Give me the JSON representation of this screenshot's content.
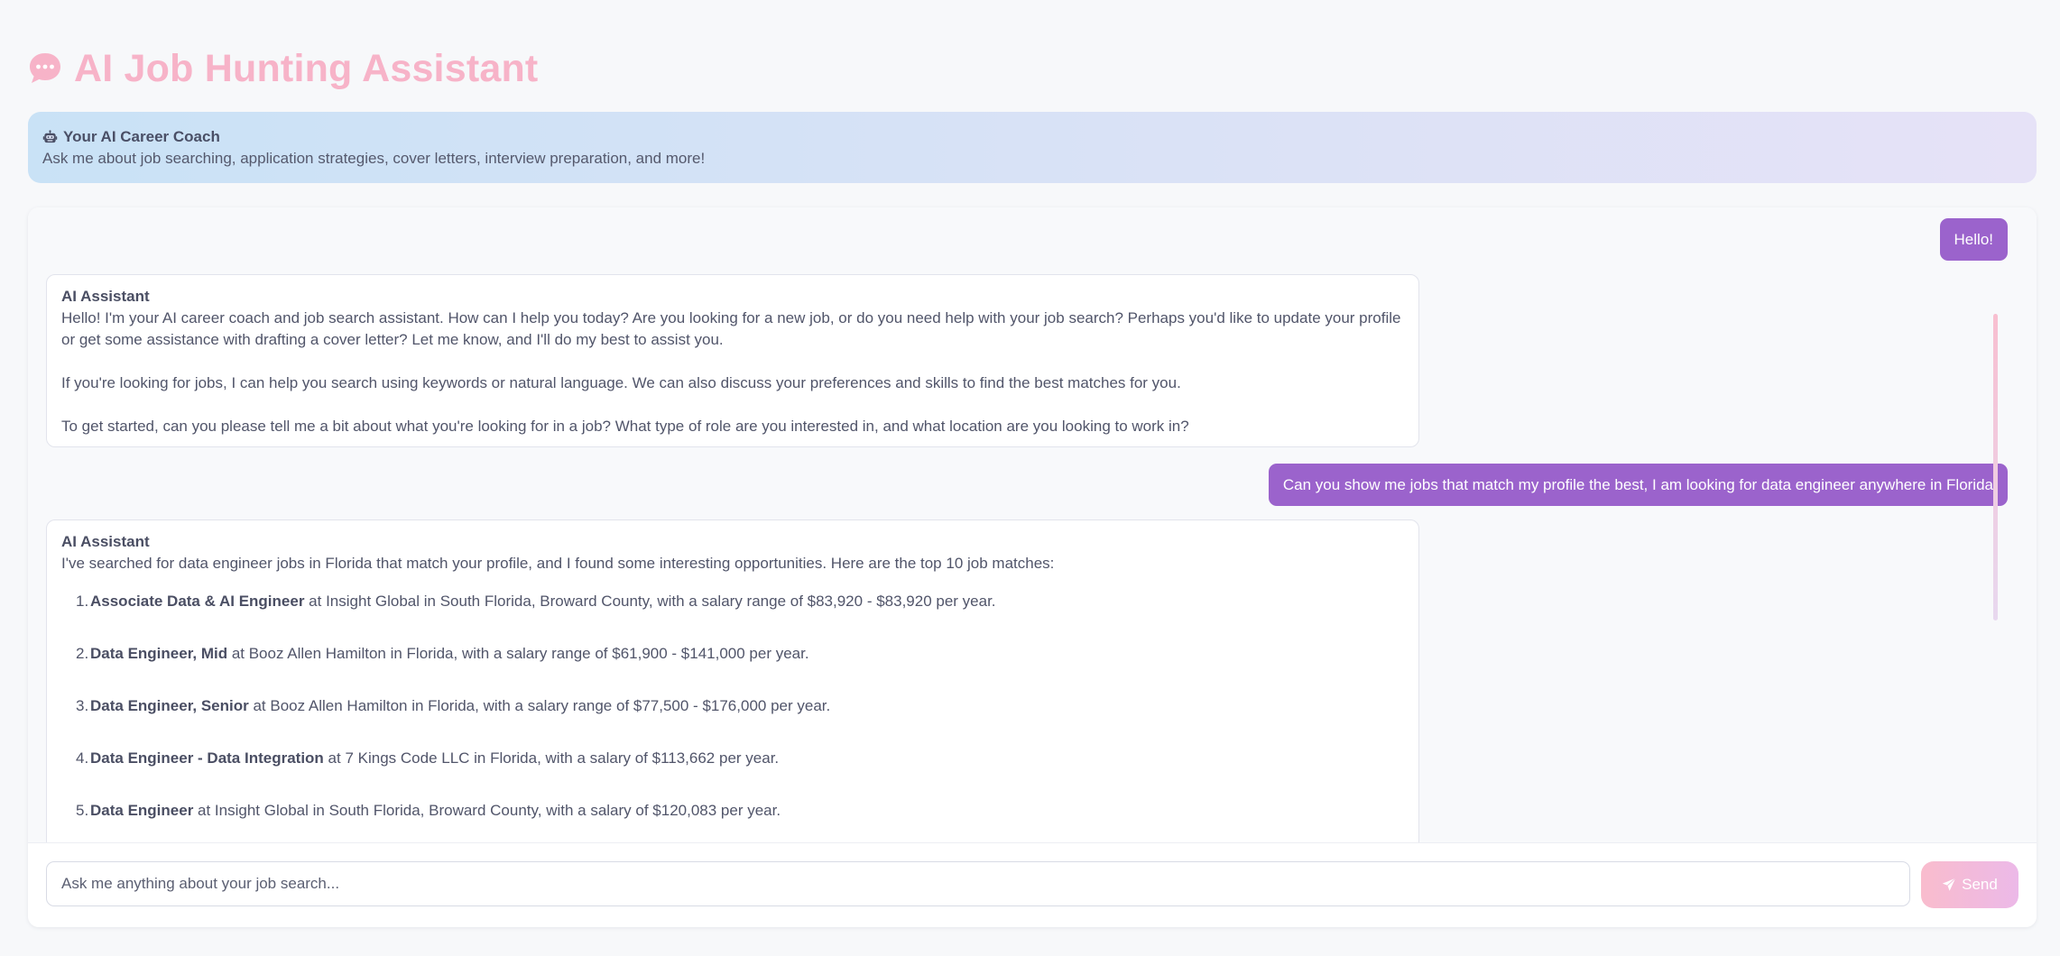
{
  "header": {
    "title": "AI Job Hunting Assistant",
    "title_icon": "speech-bubble-icon",
    "title_color": "#f7b3c8"
  },
  "coach_banner": {
    "icon": "robot-icon",
    "title": "Your AI Career Coach",
    "subtitle": "Ask me about job searching, application strategies, cover letters, interview preparation, and more!"
  },
  "chat": {
    "user_bubble_color": "#9b63cc",
    "messages": [
      {
        "role": "user",
        "text": "Hello!"
      },
      {
        "role": "assistant",
        "label": "AI Assistant",
        "paragraphs": [
          "Hello! I'm your AI career coach and job search assistant. How can I help you today? Are you looking for a new job, or do you need help with your job search? Perhaps you'd like to update your profile or get some assistance with drafting a cover letter? Let me know, and I'll do my best to assist you.",
          "If you're looking for jobs, I can help you search using keywords or natural language. We can also discuss your preferences and skills to find the best matches for you.",
          "To get started, can you please tell me a bit about what you're looking for in a job? What type of role are you interested in, and what location are you looking to work in?"
        ]
      },
      {
        "role": "user",
        "text": "Can you show me jobs that match my profile the best, I am looking for data engineer anywhere in Florida"
      },
      {
        "role": "assistant",
        "label": "AI Assistant",
        "intro": "I've searched for data engineer jobs in Florida that match your profile, and I found some interesting opportunities. Here are the top 10 job matches:",
        "jobs": [
          {
            "num": "1.",
            "title": "Associate Data & AI Engineer",
            "details": " at Insight Global in South Florida, Broward County, with a salary range of $83,920 - $83,920 per year."
          },
          {
            "num": "2.",
            "title": "Data Engineer, Mid",
            "details": " at Booz Allen Hamilton in Florida, with a salary range of $61,900 - $141,000 per year."
          },
          {
            "num": "3.",
            "title": "Data Engineer, Senior",
            "details": " at Booz Allen Hamilton in Florida, with a salary range of $77,500 - $176,000 per year."
          },
          {
            "num": "4.",
            "title": "Data Engineer - Data Integration",
            "details": " at 7 Kings Code LLC in Florida, with a salary of $113,662 per year."
          },
          {
            "num": "5.",
            "title": "Data Engineer",
            "details": " at Insight Global in South Florida, Broward County, with a salary of $120,083 per year."
          }
        ]
      }
    ]
  },
  "composer": {
    "placeholder": "Ask me anything about your job search...",
    "value": "",
    "send_label": "Send",
    "send_icon": "paper-plane-icon"
  }
}
